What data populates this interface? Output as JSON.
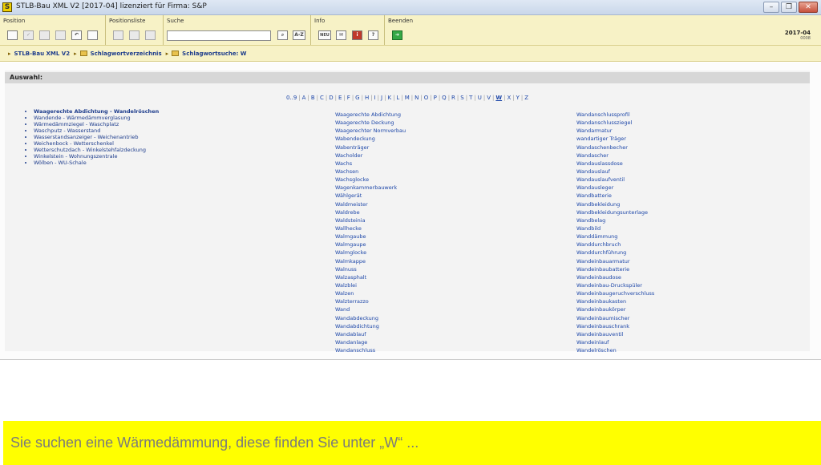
{
  "window": {
    "title": "STLB-Bau XML V2 [2017-04] lizenziert für Firma: S&P",
    "app_icon": "S"
  },
  "toolbar": {
    "groups": {
      "position": "Position",
      "positionsliste": "Positionsliste",
      "suche": "Suche",
      "info": "Info",
      "beenden": "Beenden"
    },
    "search_value": "",
    "az_label": "A-Z",
    "neu_label": "NEU",
    "help_label": "?",
    "version": "2017-04",
    "version_sub": "0008"
  },
  "breadcrumb": [
    "STLB-Bau XML V2",
    "Schlagwortverzeichnis",
    "Schlagwortsuche: W"
  ],
  "panel": {
    "header": "Auswahl:",
    "alphabet": [
      "0..9",
      "A",
      "B",
      "C",
      "D",
      "E",
      "F",
      "G",
      "H",
      "I",
      "J",
      "K",
      "L",
      "M",
      "N",
      "O",
      "P",
      "Q",
      "R",
      "S",
      "T",
      "U",
      "V",
      "W",
      "X",
      "Y",
      "Z"
    ],
    "active_letter": "W"
  },
  "selection_ranges": [
    "Waagerechte Abdichtung - Wandelröschen",
    "Wandende - Wärmedämmverglasung",
    "Wärmedämmziegel - Waschplatz",
    "Waschputz - Wasserstand",
    "Wasserstandsanzeiger - Weichenantrieb",
    "Weichenbock - Wetterschenkel",
    "Wetterschutzdach - Winkelstehfalzdeckung",
    "Winkelstein - Wohnungszentrale",
    "Wölben - WU-Schale"
  ],
  "keywords_col1": [
    "Waagerechte Abdichtung",
    "Waagerechte Deckung",
    "Waagerechter Normverbau",
    "Wabendeckung",
    "Wabenträger",
    "Wacholder",
    "Wachs",
    "Wachsen",
    "Wachsglocke",
    "Wagenkammerbauwerk",
    "Wählgerät",
    "Waldmeister",
    "Waldrebe",
    "Waldsteinia",
    "Wallhecke",
    "Walmgaube",
    "Walmgaupe",
    "Walmglocke",
    "Walmkappe",
    "Walnuss",
    "Walzasphalt",
    "Walzblei",
    "Walzen",
    "Walzterrazzo",
    "Wand",
    "Wandabdeckung",
    "Wandabdichtung",
    "Wandablauf",
    "Wandanlage",
    "Wandanschluss"
  ],
  "keywords_col2": [
    "Wandanschlussprofil",
    "Wandanschlussziegel",
    "Wandarmatur",
    "wandartiger Träger",
    "Wandaschenbecher",
    "Wandascher",
    "Wandauslassdose",
    "Wandauslauf",
    "Wandauslaufventil",
    "Wandausleger",
    "Wandbatterie",
    "Wandbekleidung",
    "Wandbekleidungsunterlage",
    "Wandbelag",
    "Wandbild",
    "Wanddämmung",
    "Wanddurchbruch",
    "Wanddurchführung",
    "Wandeinbauarmatur",
    "Wandeinbaubatterie",
    "Wandeinbaudose",
    "Wandeinbau-Druckspüler",
    "Wandeinbaugeruchverschluss",
    "Wandeinbaukasten",
    "Wandeinbaukörper",
    "Wandeinbaumischer",
    "Wandeinbauschrank",
    "Wandeinbauventil",
    "Wandeinlauf",
    "Wandelröschen"
  ],
  "banner": {
    "text": "Sie suchen eine Wärmedämmung, diese finden Sie unter „W“ ..."
  },
  "colors": {
    "toolbar_bg": "#f7f2c6",
    "link": "#1c46a8",
    "banner_bg": "#ffff00",
    "banner_text": "#7b7b7b"
  }
}
